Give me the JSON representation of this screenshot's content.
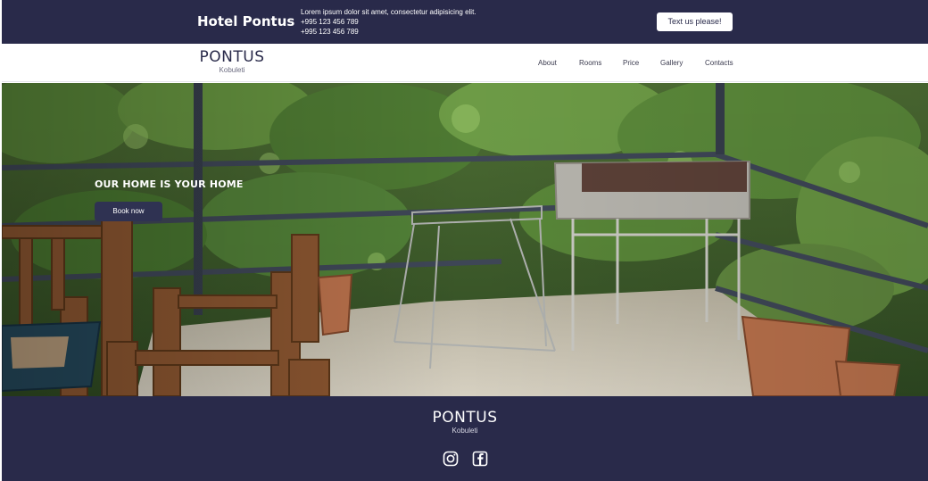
{
  "topbar": {
    "hotel_name": "Hotel Pontus",
    "tagline": "Lorem ipsum dolor sit amet, consectetur adipisicing elit.",
    "phone_1": "+995 123 456 789",
    "phone_2": "+995 123 456 789",
    "text_button": "Text us please!"
  },
  "navbar": {
    "logo_word": "PONTUS",
    "logo_city": "Kobuleti",
    "items": [
      {
        "label": "About"
      },
      {
        "label": "Rooms"
      },
      {
        "label": "Price"
      },
      {
        "label": "Gallery"
      },
      {
        "label": "Contacts"
      }
    ]
  },
  "hero": {
    "title": "OUR HOME IS YOUR HOME",
    "button": "Book now"
  },
  "footer": {
    "logo_word": "PONTUS",
    "logo_city": "Kobuleti",
    "icons": [
      "instagram-icon",
      "facebook-icon"
    ]
  },
  "colors": {
    "navy": "#292a4a",
    "white": "#ffffff"
  }
}
